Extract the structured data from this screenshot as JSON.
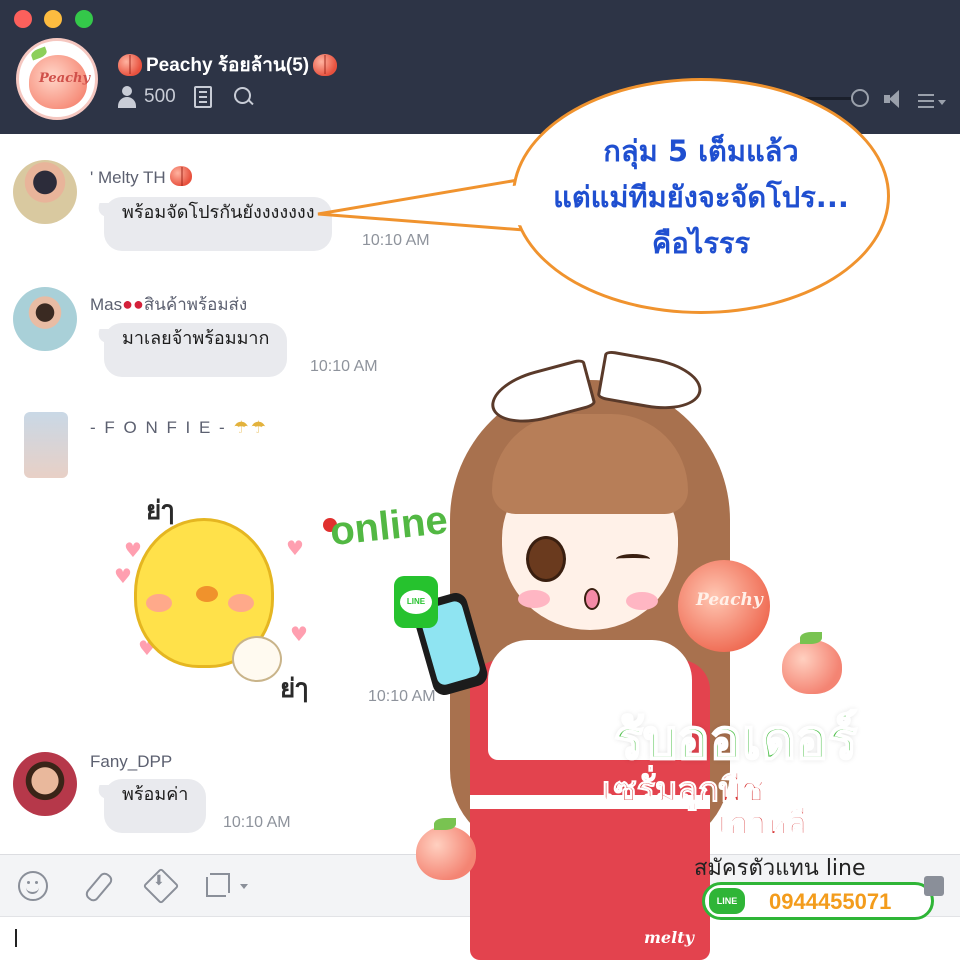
{
  "window": {
    "group_name": "Peachy ร้อยล้าน(5)",
    "member_count": "500",
    "avatar_logo": "Peachy"
  },
  "messages": [
    {
      "sender": "' Melty TH",
      "text": "พร้อมจัดโปรกันยังงงงงงง",
      "time": "10:10 AM"
    },
    {
      "sender": "Mas",
      "sender_suffix": "สินค้าพร้อมส่ง",
      "text": "มาเลยจ้าพร้อมมาก",
      "time": "10:10 AM"
    },
    {
      "sender": "- F O N F I E -",
      "sticker_text_top": "ย่ๅ",
      "sticker_text_bottom": "ย่ๅ",
      "time": "10:10 AM"
    },
    {
      "sender": "Fany_DPP",
      "text": "พร้อมค่า",
      "time": "10:10 AM"
    }
  ],
  "callout": {
    "line1": "กลุ่ม 5 เต็มแล้ว",
    "line2": "แต่แม่ทีมยังจะจัดโปร...",
    "line3": "คือไรรร"
  },
  "promo": {
    "online": "online",
    "line_badge": "LINE",
    "jar_label": "Peachy",
    "headline": "รับออเดอร์",
    "product_line1": "เซรั่มลูกพีช",
    "product_line2": "เกาหลี",
    "agent_text": "สมัครตัวแทน line",
    "phone_badge": "LINE",
    "phone_number": "0944455071",
    "brand_tag": "melty"
  },
  "icons": [
    "user-icon",
    "notes-icon",
    "search-icon",
    "speaker-icon",
    "menu-icon",
    "smile-icon",
    "paperclip-icon",
    "save-icon",
    "crop-icon"
  ],
  "colors": {
    "header_bg": "#2d3446",
    "bubble_bg": "#e9eaee",
    "callout_border": "#f0932e",
    "callout_text": "#1f4fd0",
    "line_green": "#2fb537"
  }
}
